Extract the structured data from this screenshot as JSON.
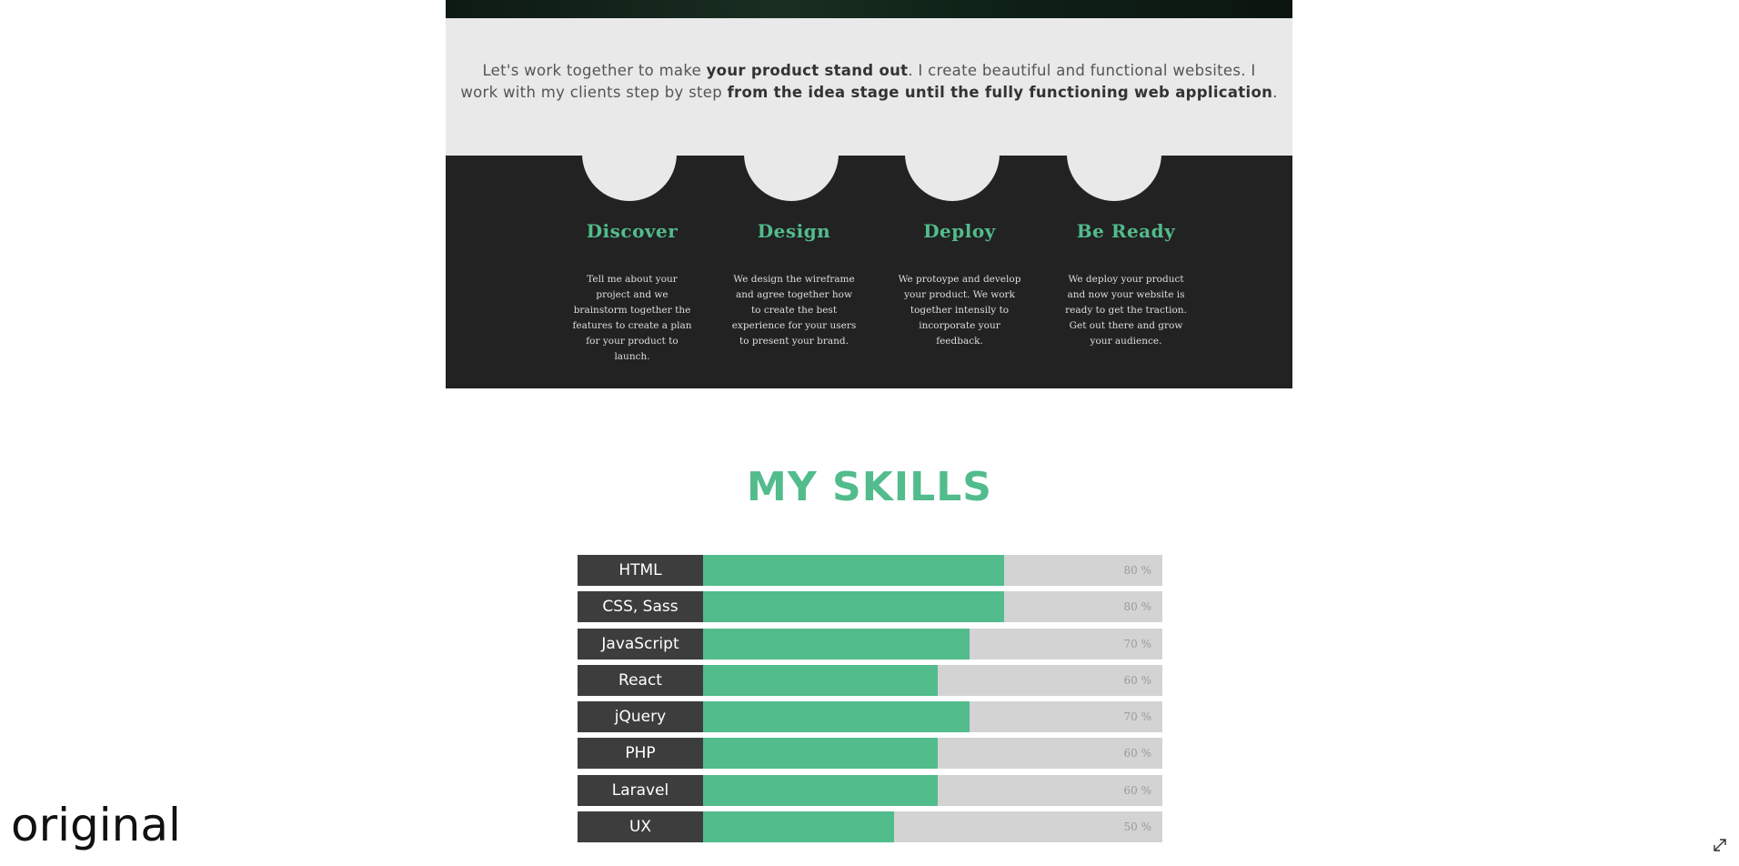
{
  "intro": {
    "line1_pre": "Let's work together to make ",
    "line1_bold": "your product stand out",
    "line1_post": ". I create beautiful and functional websites. I",
    "line2_pre": "work with my clients step by step ",
    "line2_bold": "from the idea stage until the fully functioning web application",
    "line2_post": "."
  },
  "process": {
    "steps": [
      {
        "title": "Discover",
        "desc": "Tell me about your project and we brainstorm together the features to create a plan for your product to launch."
      },
      {
        "title": "Design",
        "desc": "We design the wireframe and agree together how to create the best experience for your users to present your brand."
      },
      {
        "title": "Deploy",
        "desc": "We protoype and develop your product. We work together intensily to incorporate your feedback."
      },
      {
        "title": "Be Ready",
        "desc": "We deploy your product and now your website is ready to get the traction. Get out there and grow your audience."
      }
    ]
  },
  "skills": {
    "title": "MY SKILLS",
    "items": [
      {
        "label": "HTML",
        "percent": 80,
        "percent_text": "80 %"
      },
      {
        "label": "CSS, Sass",
        "percent": 80,
        "percent_text": "80 %"
      },
      {
        "label": "JavaScript",
        "percent": 70,
        "percent_text": "70 %"
      },
      {
        "label": "React",
        "percent": 60,
        "percent_text": "60 %"
      },
      {
        "label": "jQuery",
        "percent": 70,
        "percent_text": "70 %"
      },
      {
        "label": "PHP",
        "percent": 60,
        "percent_text": "60 %"
      },
      {
        "label": "Laravel",
        "percent": 60,
        "percent_text": "60 %"
      },
      {
        "label": "UX",
        "percent": 50,
        "percent_text": "50 %"
      }
    ]
  },
  "caption": "original",
  "colors": {
    "accent": "#52bc8c",
    "dark": "#222222",
    "light": "#e9e9e9"
  },
  "icons": {
    "expand": "expand-icon"
  }
}
